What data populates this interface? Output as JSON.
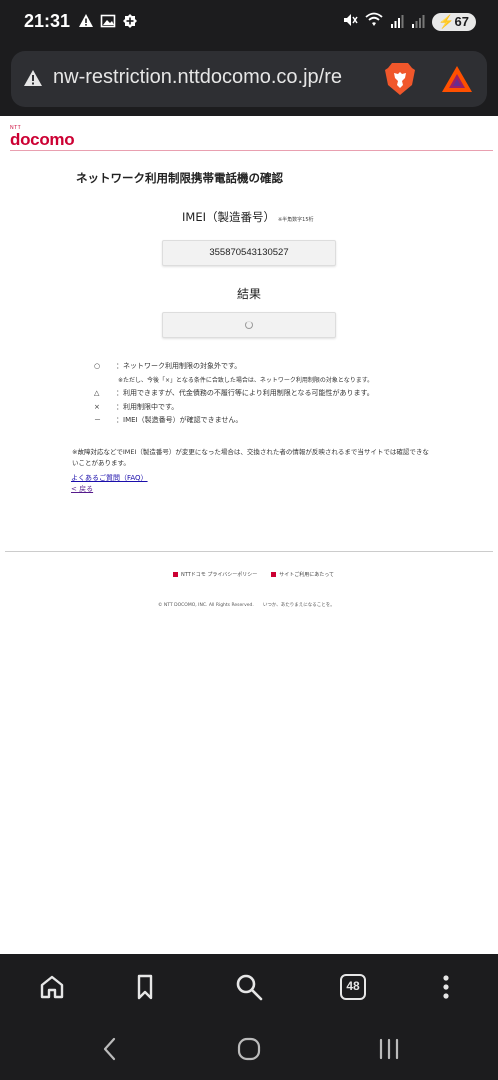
{
  "status_bar": {
    "time": "21:31",
    "battery": "67",
    "left_icons": [
      "warning-icon",
      "image-icon",
      "badge-plus-icon"
    ],
    "right_icons": [
      "mute-icon",
      "wifi-icon",
      "signal-icon",
      "signal-icon"
    ]
  },
  "browser": {
    "url": "nw-restriction.nttdocomo.co.jp/re",
    "tab_count": "48"
  },
  "page": {
    "logo_small": "NTT",
    "logo": "docomo",
    "title": "ネットワーク利用制限携帯電話機の確認",
    "imei_label": "IMEI（製造番号）",
    "imei_note": "※半角数字15桁",
    "imei_value": "355870543130527",
    "result_label": "結果",
    "legend": [
      {
        "symbol": "○",
        "text": "ネットワーク利用制限の対象外です。"
      },
      {
        "symbol": "△",
        "text": "利用できますが、代金債務の不履行等により利用制限となる可能性があります。"
      },
      {
        "symbol": "×",
        "text": "利用制限中です。"
      },
      {
        "symbol": "－",
        "text": "IMEI（製造番号）が確認できません。"
      }
    ],
    "legend_sub": "※ただし、今後「×」となる条件に合致した場合は、ネットワーク利用制限の対象となります。",
    "note": "※故障対応などでIMEI（製造番号）が変更になった場合は、交換された者の情報が反映されるまで当サイトでは確認できないことがあります。",
    "faq_link": "よくあるご質問（FAQ）",
    "back_link": "< 戻る",
    "footer_links": [
      "NTTドコモ プライバシーポリシー",
      "サイトご利用にあたって"
    ],
    "copyright": "© NTT DOCOMO, INC. All Rights Reserved.　　いつか、あたりまえになることを。"
  },
  "colors": {
    "brand": "#cc0033",
    "chrome": "#1c1c1e",
    "brave_orange": "#f0572b"
  }
}
